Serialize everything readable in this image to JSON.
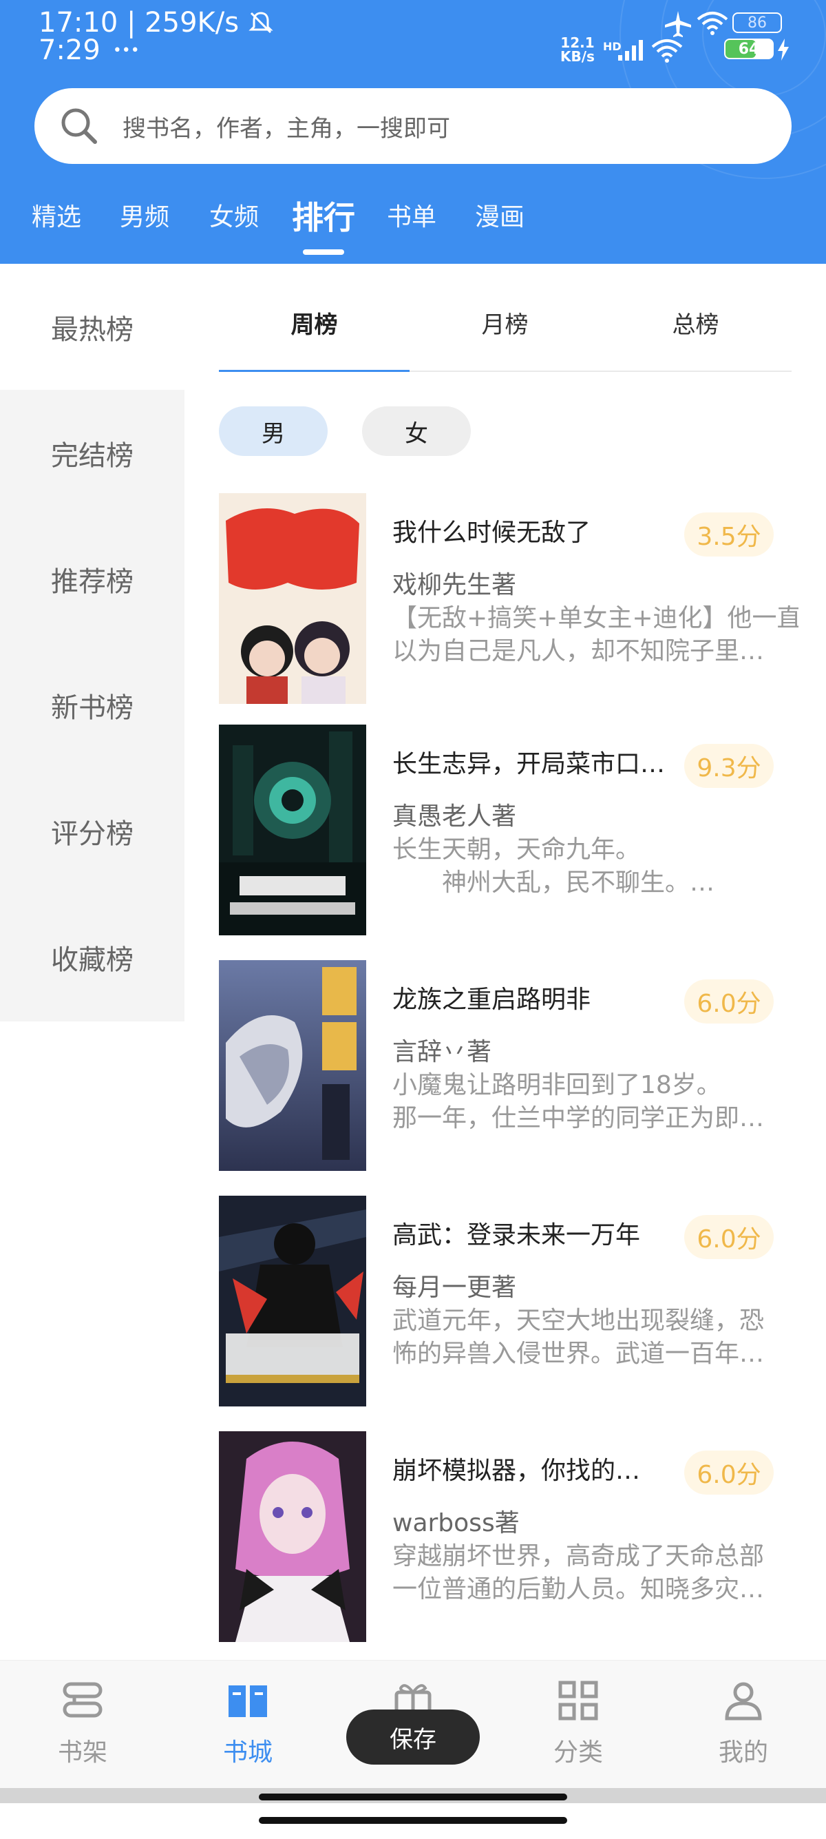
{
  "status_bar": {
    "time_net": "17:10 | 259K/s",
    "time2": "7:29",
    "dots": "•••",
    "speed_top": "12.1",
    "speed_bottom": "KB/s",
    "hd": "HD",
    "battery_top": "86",
    "battery_bottom": "64"
  },
  "search": {
    "placeholder": "搜书名，作者，主角，一搜即可"
  },
  "top_tabs": [
    {
      "label": "精选"
    },
    {
      "label": "男频"
    },
    {
      "label": "女频"
    },
    {
      "label": "排行",
      "active": true
    },
    {
      "label": "书单"
    },
    {
      "label": "漫画"
    }
  ],
  "rank_sidebar": [
    {
      "label": "最热榜",
      "active": true
    },
    {
      "label": "完结榜"
    },
    {
      "label": "推荐榜"
    },
    {
      "label": "新书榜"
    },
    {
      "label": "评分榜"
    },
    {
      "label": "收藏榜"
    }
  ],
  "period_tabs": [
    {
      "label": "周榜",
      "active": true
    },
    {
      "label": "月榜"
    },
    {
      "label": "总榜"
    }
  ],
  "gender_filters": [
    {
      "label": "男",
      "active": true
    },
    {
      "label": "女"
    }
  ],
  "books": [
    {
      "title": "我什么时候无敌了",
      "score": "3.5分",
      "author": "戏柳先生著",
      "desc_line1": "【无敌+搞笑+单女主+迪化】他一直",
      "desc_line2": "以为自己是凡人，却不知院子里…",
      "cover_colors": [
        "#f4e9dc",
        "#e23b2e"
      ]
    },
    {
      "title": "长生志异，开局菜市口…",
      "score": "9.3分",
      "author": "真愚老人著",
      "desc_line1": "长生天朝，天命九年。",
      "desc_line2": "　　神州大乱，民不聊生。…",
      "cover_colors": [
        "#0c1a1a",
        "#2aa38c"
      ]
    },
    {
      "title": "龙族之重启路明非",
      "score": "6.0分",
      "author": "言辞丷著",
      "desc_line1": "小魔鬼让路明非回到了18岁。",
      "desc_line2": "那一年，仕兰中学的同学正为即…",
      "cover_colors": [
        "#4a5a8a",
        "#e8b84a"
      ]
    },
    {
      "title": "高武：登录未来一万年",
      "score": "6.0分",
      "author": "每月一更著",
      "desc_line1": "武道元年，天空大地出现裂缝，恐",
      "desc_line2": "怖的异兽入侵世界。武道一百年…",
      "cover_colors": [
        "#1a1f2e",
        "#d8382e"
      ]
    },
    {
      "title": "崩坏模拟器，你找的…",
      "score": "6.0分",
      "author": "warboss著",
      "desc_line1": "穿越崩坏世界，高奇成了天命总部",
      "desc_line2": "一位普通的后勤人员。知晓多灾…",
      "cover_colors": [
        "#2a1c2a",
        "#d97fc8"
      ]
    }
  ],
  "bottom_nav": [
    {
      "label": "书架",
      "icon": "bookshelf-icon"
    },
    {
      "label": "书城",
      "icon": "book-open-icon",
      "active": true
    },
    {
      "label": "",
      "icon": "gift-icon"
    },
    {
      "label": "分类",
      "icon": "grid-icon"
    },
    {
      "label": "我的",
      "icon": "user-icon"
    }
  ],
  "toast": {
    "label": "保存"
  },
  "colors": {
    "primary": "#3d8ef0",
    "score": "#f0b84a",
    "score_bg": "#fff6e4"
  }
}
